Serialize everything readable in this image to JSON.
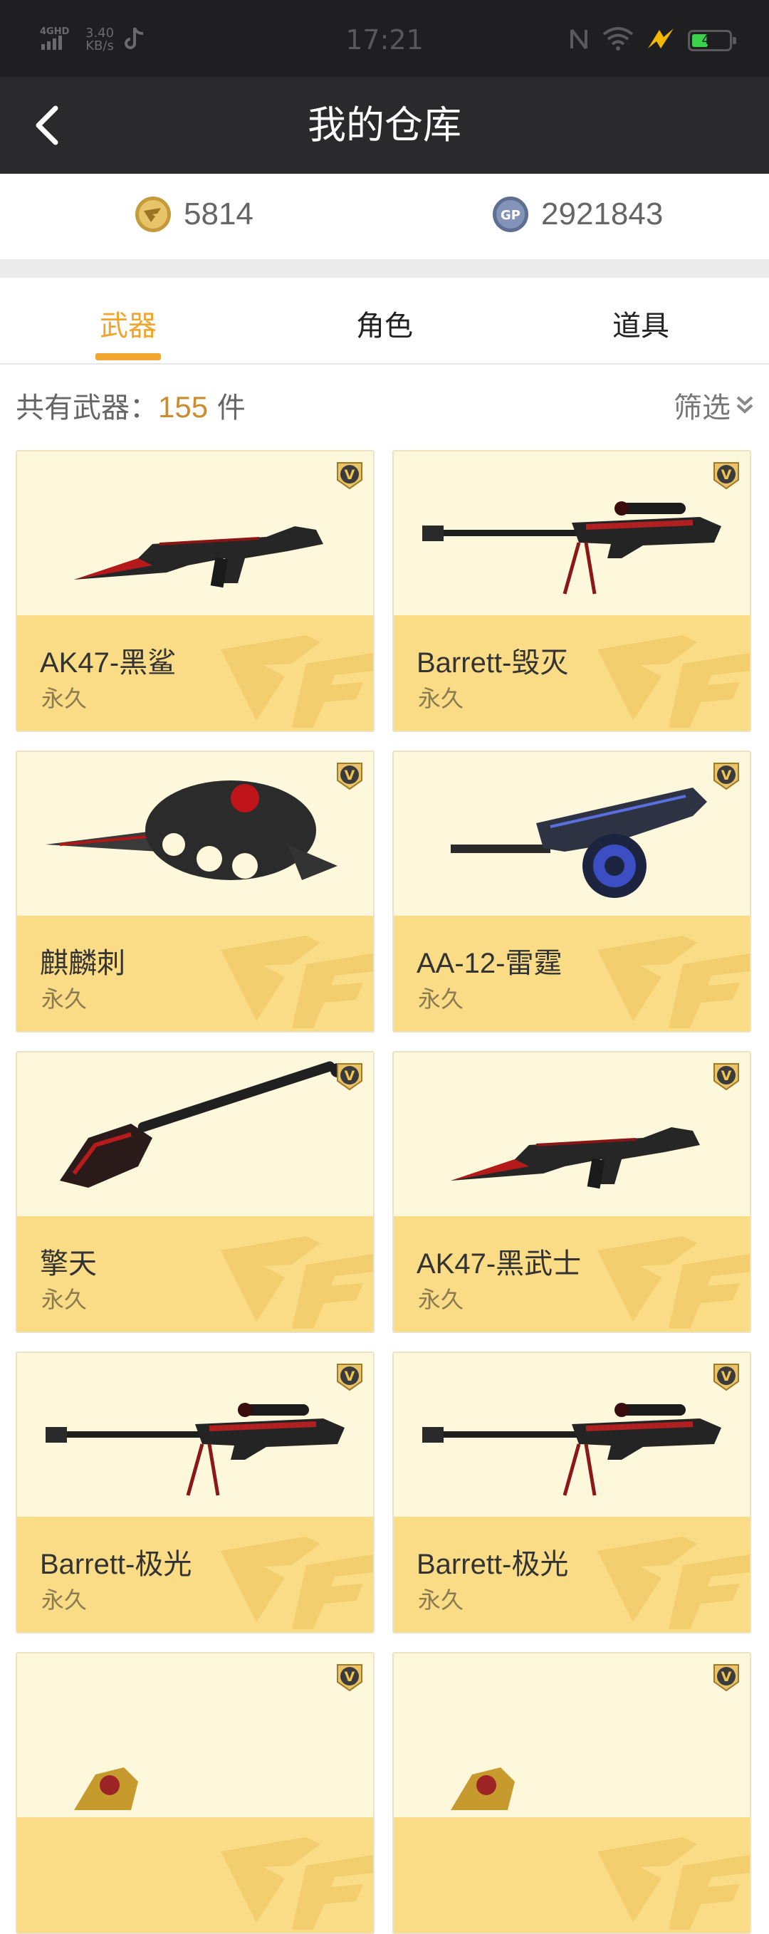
{
  "status_bar": {
    "network": "4GHD",
    "speed_value": "3.40",
    "speed_unit": "KB/s",
    "time": "17:21",
    "battery": "41"
  },
  "header": {
    "title": "我的仓库"
  },
  "currency": {
    "cf_points": "5814",
    "gp_points": "2921843",
    "gp_label": "GP"
  },
  "tabs": [
    {
      "label": "武器",
      "active": true
    },
    {
      "label": "角色",
      "active": false
    },
    {
      "label": "道具",
      "active": false
    }
  ],
  "summary": {
    "label": "共有武器：",
    "count": "155",
    "unit": " 件",
    "filter_label": "筛选"
  },
  "items": [
    {
      "name": "AK47-黑鲨",
      "term": "永久",
      "badge": "V",
      "weapon_icon": "rifle-icon"
    },
    {
      "name": "Barrett-毁灭",
      "term": "永久",
      "badge": "V",
      "weapon_icon": "sniper-icon"
    },
    {
      "name": "麒麟刺",
      "term": "永久",
      "badge": "V",
      "weapon_icon": "knuckle-knife-icon"
    },
    {
      "name": "AA-12-雷霆",
      "term": "永久",
      "badge": "V",
      "weapon_icon": "shotgun-icon"
    },
    {
      "name": "擎天",
      "term": "永久",
      "badge": "V",
      "weapon_icon": "shovel-icon"
    },
    {
      "name": "AK47-黑武士",
      "term": "永久",
      "badge": "V",
      "weapon_icon": "rifle-icon"
    },
    {
      "name": "Barrett-极光",
      "term": "永久",
      "badge": "V",
      "weapon_icon": "sniper-icon"
    },
    {
      "name": "Barrett-极光",
      "term": "永久",
      "badge": "V",
      "weapon_icon": "sniper-icon"
    },
    {
      "name": "",
      "term": "",
      "badge": "V",
      "weapon_icon": "gold-weapon-icon"
    },
    {
      "name": "",
      "term": "",
      "badge": "V",
      "weapon_icon": "gold-weapon-icon"
    }
  ],
  "colors": {
    "accent": "#f2a52c",
    "card_top": "#fdf7db",
    "card_bottom": "#f9dc85",
    "header": "#2a2a2c"
  }
}
